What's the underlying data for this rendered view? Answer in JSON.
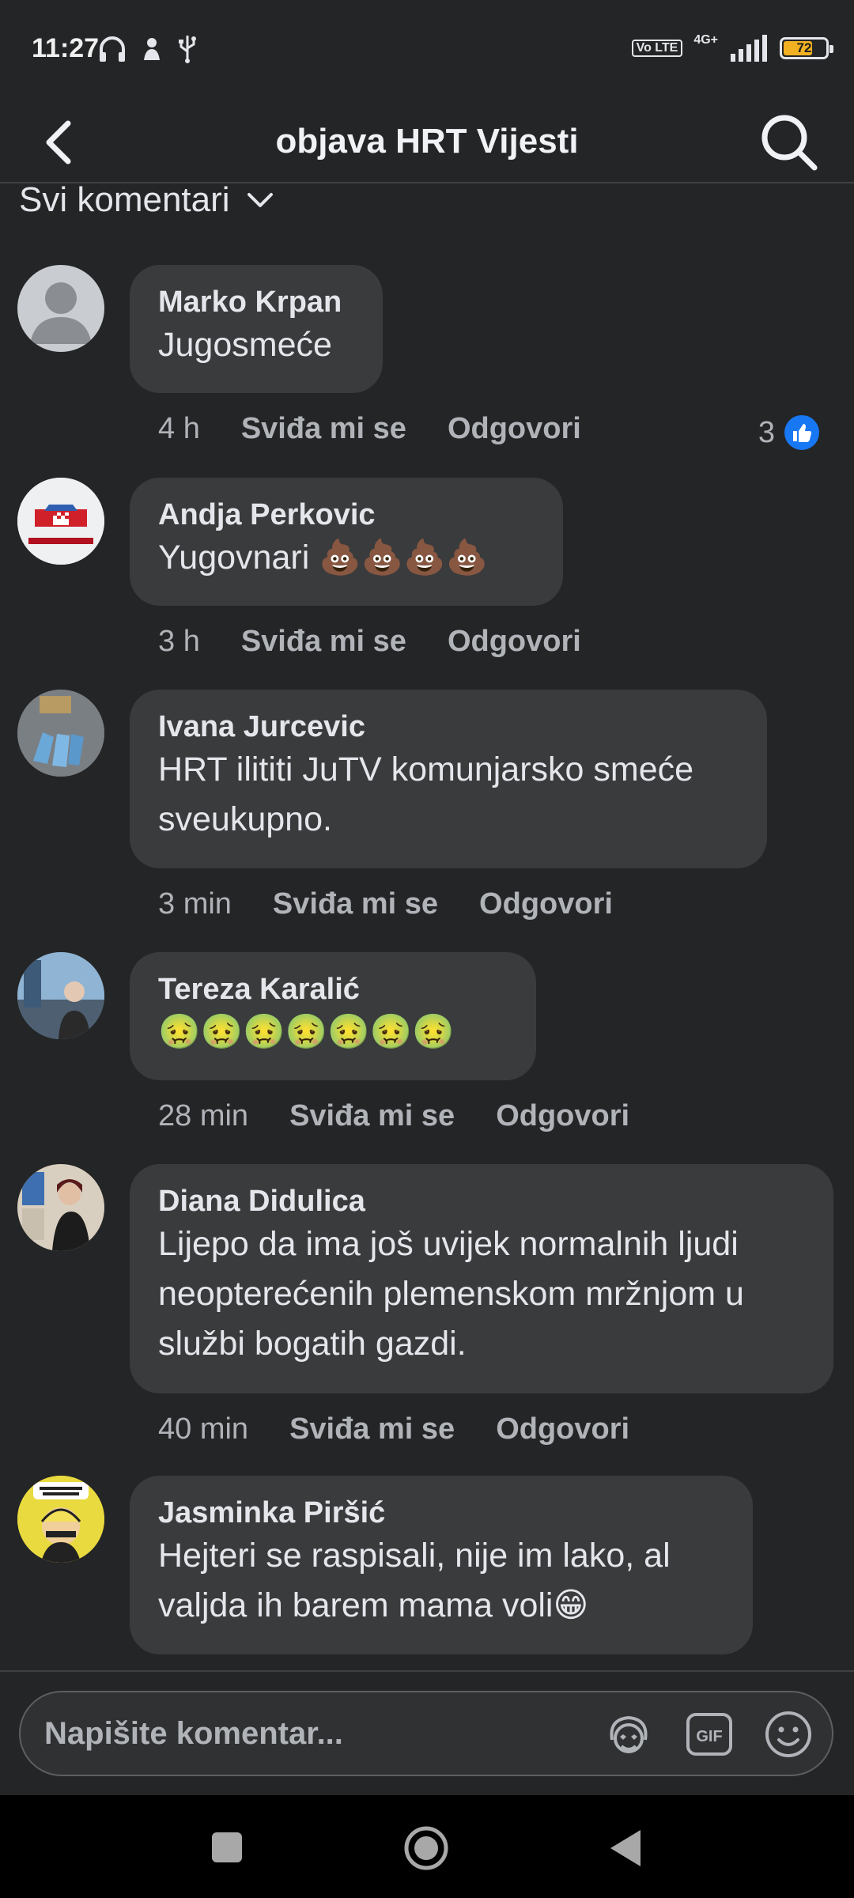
{
  "status_bar": {
    "time": "11:27",
    "volte": "Vo LTE",
    "network": "4G+",
    "battery": "72",
    "battery_level": 0.72
  },
  "header": {
    "title": "objava HRT Vijesti"
  },
  "filter": {
    "label": "Svi komentari"
  },
  "comments": [
    {
      "author": "Marko Krpan",
      "text": "Jugosmeće",
      "time": "4 h",
      "like": "Sviđa mi se",
      "reply": "Odgovori",
      "likes": "3"
    },
    {
      "author": "Andja Perkovic",
      "text": "Yugovnari 💩💩💩💩",
      "time": "3 h",
      "like": "Sviđa mi se",
      "reply": "Odgovori"
    },
    {
      "author": "Ivana Jurcevic",
      "text": "HRT ilititi JuTV komunjarsko smeće sveukupno.",
      "time": "3 min",
      "like": "Sviđa mi se",
      "reply": "Odgovori"
    },
    {
      "author": "Tereza Karalić",
      "text": "🤢🤢🤢🤢🤢🤢🤢",
      "time": "28 min",
      "like": "Sviđa mi se",
      "reply": "Odgovori"
    },
    {
      "author": "Diana Didulica",
      "text": "Lijepo da ima još uvijek normalnih ljudi neopterećenih plemenskom mržnjom u službi bogatih gazdi.",
      "time": "40 min",
      "like": "Sviđa mi se",
      "reply": "Odgovori"
    },
    {
      "author": "Jasminka Piršić",
      "text": "Hejteri se raspisali, nije im lako, al valjda ih barem mama voli😁"
    }
  ],
  "composer": {
    "placeholder": "Napišite komentar..."
  },
  "colors": {
    "background": "#242526",
    "bubble": "#3a3b3c",
    "like_blue": "#1877f2",
    "battery": "#f2b122"
  }
}
